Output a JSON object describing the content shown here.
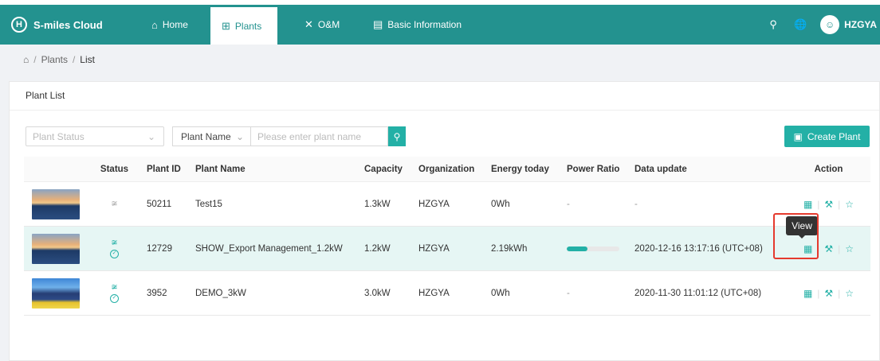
{
  "app": {
    "name": "S-miles Cloud",
    "logo_letter": "H"
  },
  "nav": [
    {
      "label": "Home",
      "icon": "home-icon",
      "glyph": "⌂"
    },
    {
      "label": "Plants",
      "icon": "plants-icon",
      "glyph": "⊞"
    },
    {
      "label": "O&M",
      "icon": "tools-icon",
      "glyph": "✕"
    },
    {
      "label": "Basic Information",
      "icon": "document-icon",
      "glyph": "▤"
    }
  ],
  "user": {
    "name": "HZGYA"
  },
  "breadcrumb": {
    "items": [
      "Plants",
      "List"
    ],
    "sep": "/"
  },
  "card": {
    "title": "Plant List"
  },
  "filters": {
    "status_placeholder": "Plant Status",
    "name_select": "Plant Name",
    "name_placeholder": "Please enter plant name"
  },
  "create_button": "Create Plant",
  "table": {
    "headers": [
      "Status",
      "Plant ID",
      "Plant Name",
      "Capacity",
      "Organization",
      "Energy today",
      "Power Ratio",
      "Data update",
      "Action"
    ],
    "rows": [
      {
        "plant_id": "50211",
        "plant_name": "Test15",
        "capacity": "1.3kW",
        "organization": "HZGYA",
        "energy_today": "0Wh",
        "power_ratio": "-",
        "data_update": "-",
        "online": false,
        "image": "sunset-panels"
      },
      {
        "plant_id": "12729",
        "plant_name": "SHOW_Export Management_1.2kW",
        "capacity": "1.2kW",
        "organization": "HZGYA",
        "energy_today": "2.19kWh",
        "power_ratio_fill": 0.4,
        "data_update": "2020-12-16 13:17:16 (UTC+08)",
        "online": true,
        "image": "sunset-panels"
      },
      {
        "plant_id": "3952",
        "plant_name": "DEMO_3kW",
        "capacity": "3.0kW",
        "organization": "HZGYA",
        "energy_today": "0Wh",
        "power_ratio": "-",
        "data_update": "2020-11-30 11:01:12 (UTC+08)",
        "online": true,
        "image": "sunflower-panels"
      }
    ]
  },
  "tooltip": {
    "text": "View"
  },
  "colors": {
    "primary": "#23928f",
    "accent": "#23b0a6",
    "highlight": "#e53a2e"
  }
}
